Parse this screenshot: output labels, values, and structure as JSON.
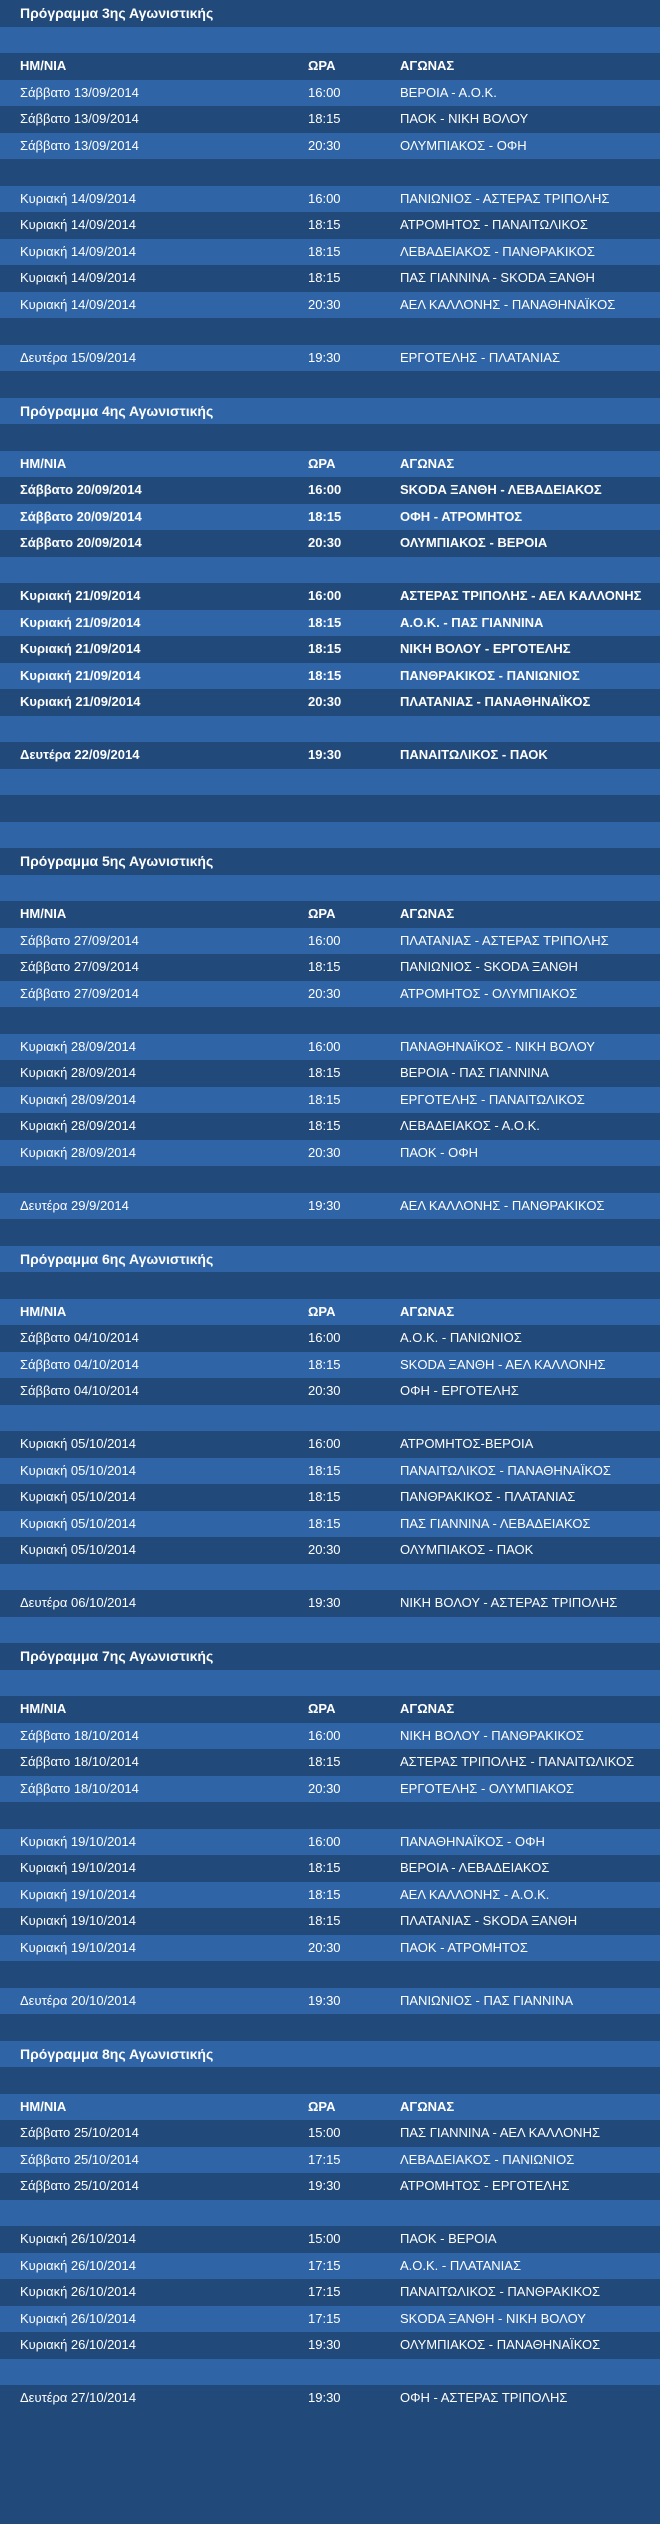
{
  "header": {
    "date": "ΗΜ/ΝΙΑ",
    "time": "ΩΡΑ",
    "match": "ΑΓΩΝΑΣ"
  },
  "rounds": [
    {
      "title": "Πρόγραμμα 3ης Αγωνιστικής",
      "bold": false,
      "groups": [
        [
          [
            "Σάββατο 13/09/2014",
            "16:00",
            "ΒΕΡΟΙΑ - Α.Ο.Κ."
          ],
          [
            "Σάββατο 13/09/2014",
            "18:15",
            "ΠΑΟΚ - ΝΙΚΗ ΒΟΛΟΥ"
          ],
          [
            "Σάββατο 13/09/2014",
            "20:30",
            "ΟΛΥΜΠΙΑΚΟΣ - ΟΦΗ"
          ]
        ],
        [
          [
            "Κυριακή 14/09/2014",
            "16:00",
            "ΠΑΝΙΩΝΙΟΣ - ΑΣΤΕΡΑΣ ΤΡΙΠΟΛΗΣ"
          ],
          [
            "Κυριακή 14/09/2014",
            "18:15",
            "ΑΤΡΟΜΗΤΟΣ - ΠΑΝΑΙΤΩΛΙΚΟΣ"
          ],
          [
            "Κυριακή 14/09/2014",
            "18:15",
            "ΛΕΒΑΔΕΙΑΚΟΣ - ΠΑΝΘΡΑΚΙΚΟΣ"
          ],
          [
            "Κυριακή 14/09/2014",
            "18:15",
            "ΠΑΣ ΓΙΑΝΝΙΝΑ - SKODA ΞΑΝΘΗ"
          ],
          [
            "Κυριακή 14/09/2014",
            "20:30",
            "ΑΕΛ ΚΑΛΛΟΝΗΣ - ΠΑΝΑΘΗΝΑΪΚΟΣ"
          ]
        ],
        [
          [
            "Δευτέρα 15/09/2014",
            "19:30",
            "ΕΡΓΟΤΕΛΗΣ - ΠΛΑΤΑΝΙΑΣ"
          ]
        ]
      ]
    },
    {
      "title": "Πρόγραμμα 4ης Αγωνιστικής",
      "bold": true,
      "groups": [
        [
          [
            "Σάββατο 20/09/2014",
            "16:00",
            "SKODA ΞΑΝΘΗ - ΛΕΒΑΔΕΙΑΚΟΣ"
          ],
          [
            "Σάββατο 20/09/2014",
            "18:15",
            "ΟΦΗ - ΑΤΡΟΜΗΤΟΣ"
          ],
          [
            "Σάββατο 20/09/2014",
            "20:30",
            "ΟΛΥΜΠΙΑΚΟΣ - ΒΕΡΟΙΑ"
          ]
        ],
        [
          [
            "Κυριακή 21/09/2014",
            "16:00",
            "ΑΣΤΕΡΑΣ ΤΡΙΠΟΛΗΣ - ΑΕΛ ΚΑΛΛΟΝΗΣ"
          ],
          [
            "Κυριακή 21/09/2014",
            "18:15",
            "Α.Ο.Κ. - ΠΑΣ ΓΙΑΝΝΙΝΑ"
          ],
          [
            "Κυριακή 21/09/2014",
            "18:15",
            "ΝΙΚΗ ΒΟΛΟΥ - ΕΡΓΟΤΕΛΗΣ"
          ],
          [
            "Κυριακή 21/09/2014",
            "18:15",
            "ΠΑΝΘΡΑΚΙΚΟΣ - ΠΑΝΙΩΝΙΟΣ"
          ],
          [
            "Κυριακή 21/09/2014",
            "20:30",
            "ΠΛΑΤΑΝΙΑΣ - ΠΑΝΑΘΗΝΑΪΚΟΣ"
          ]
        ],
        [
          [
            "Δευτέρα 22/09/2014",
            "19:30",
            "ΠΑΝΑΙΤΩΛΙΚΟΣ - ΠΑΟΚ"
          ]
        ]
      ]
    },
    {
      "title": "Πρόγραμμα 5ης Αγωνιστικής",
      "bold": false,
      "groups": [
        [
          [
            "Σάββατο 27/09/2014",
            "16:00",
            "ΠΛΑΤΑΝΙΑΣ - ΑΣΤΕΡΑΣ ΤΡΙΠΟΛΗΣ"
          ],
          [
            "Σάββατο 27/09/2014",
            "18:15",
            "ΠΑΝΙΩΝΙΟΣ - SKODA ΞΑΝΘΗ"
          ],
          [
            "Σάββατο 27/09/2014",
            "20:30",
            "ΑΤΡΟΜΗΤΟΣ - ΟΛΥΜΠΙΑΚΟΣ"
          ]
        ],
        [
          [
            "Κυριακή 28/09/2014",
            "16:00",
            "ΠΑΝΑΘΗΝΑΪΚΟΣ - ΝΙΚΗ ΒΟΛΟΥ"
          ],
          [
            "Κυριακή 28/09/2014",
            "18:15",
            "ΒΕΡΟΙΑ - ΠΑΣ ΓΙΑΝΝΙΝΑ"
          ],
          [
            "Κυριακή 28/09/2014",
            "18:15",
            "ΕΡΓΟΤΕΛΗΣ - ΠΑΝΑΙΤΩΛΙΚΟΣ"
          ],
          [
            "Κυριακή 28/09/2014",
            "18:15",
            "ΛΕΒΑΔΕΙΑΚΟΣ - Α.Ο.Κ."
          ],
          [
            "Κυριακή 28/09/2014",
            "20:30",
            "ΠΑΟΚ - ΟΦΗ"
          ]
        ],
        [
          [
            "Δευτέρα 29/9/2014",
            "19:30",
            "ΑΕΛ ΚΑΛΛΟΝΗΣ - ΠΑΝΘΡΑΚΙΚΟΣ"
          ]
        ]
      ]
    },
    {
      "title": "Πρόγραμμα 6ης Αγωνιστικής",
      "bold": false,
      "groups": [
        [
          [
            "Σάββατο 04/10/2014",
            "16:00",
            "Α.Ο.Κ. - ΠΑΝΙΩΝΙΟΣ"
          ],
          [
            "Σάββατο 04/10/2014",
            "18:15",
            "SKODA ΞΑΝΘΗ - ΑΕΛ ΚΑΛΛΟΝΗΣ"
          ],
          [
            "Σάββατο 04/10/2014",
            "20:30",
            "ΟΦΗ - ΕΡΓΟΤΕΛΗΣ"
          ]
        ],
        [
          [
            "Κυριακή 05/10/2014",
            "16:00",
            "ΑΤΡΟΜΗΤΟΣ-ΒΕΡΟΙΑ"
          ],
          [
            "Κυριακή 05/10/2014",
            "18:15",
            "ΠΑΝΑΙΤΩΛΙΚΟΣ - ΠΑΝΑΘΗΝΑΪΚΟΣ"
          ],
          [
            "Κυριακή 05/10/2014",
            "18:15",
            "ΠΑΝΘΡΑΚΙΚΟΣ - ΠΛΑΤΑΝΙΑΣ"
          ],
          [
            "Κυριακή 05/10/2014",
            "18:15",
            "ΠΑΣ ΓΙΑΝΝΙΝΑ - ΛΕΒΑΔΕΙΑΚΟΣ"
          ],
          [
            "Κυριακή 05/10/2014",
            "20:30",
            "ΟΛΥΜΠΙΑΚΟΣ - ΠΑΟΚ"
          ]
        ],
        [
          [
            "Δευτέρα 06/10/2014",
            "19:30",
            "ΝΙΚΗ ΒΟΛΟΥ - ΑΣΤΕΡΑΣ ΤΡΙΠΟΛΗΣ"
          ]
        ]
      ]
    },
    {
      "title": "Πρόγραμμα 7ης Αγωνιστικής",
      "bold": false,
      "groups": [
        [
          [
            "Σάββατο 18/10/2014",
            "16:00",
            "ΝΙΚΗ ΒΟΛΟΥ - ΠΑΝΘΡΑΚΙΚΟΣ"
          ],
          [
            "Σάββατο 18/10/2014",
            "18:15",
            "ΑΣΤΕΡΑΣ ΤΡΙΠΟΛΗΣ - ΠΑΝΑΙΤΩΛΙΚΟΣ"
          ],
          [
            "Σάββατο 18/10/2014",
            "20:30",
            "ΕΡΓΟΤΕΛΗΣ - ΟΛΥΜΠΙΑΚΟΣ"
          ]
        ],
        [
          [
            "Κυριακή 19/10/2014",
            "16:00",
            "ΠΑΝΑΘΗΝΑΪΚΟΣ - ΟΦΗ"
          ],
          [
            "Κυριακή 19/10/2014",
            "18:15",
            "ΒΕΡΟΙΑ - ΛΕΒΑΔΕΙΑΚΟΣ"
          ],
          [
            "Κυριακή 19/10/2014",
            "18:15",
            "ΑΕΛ ΚΑΛΛΟΝΗΣ - Α.Ο.Κ."
          ],
          [
            "Κυριακή 19/10/2014",
            "18:15",
            "ΠΛΑΤΑΝΙΑΣ - SKODA ΞΑΝΘΗ"
          ],
          [
            "Κυριακή 19/10/2014",
            "20:30",
            "ΠΑΟΚ - ΑΤΡΟΜΗΤΟΣ"
          ]
        ],
        [
          [
            "Δευτέρα 20/10/2014",
            "19:30",
            "ΠΑΝΙΩΝΙΟΣ - ΠΑΣ ΓΙΑΝΝΙΝΑ"
          ]
        ]
      ]
    },
    {
      "title": "Πρόγραμμα 8ης Αγωνιστικής",
      "bold": false,
      "groups": [
        [
          [
            "Σάββατο 25/10/2014",
            "15:00",
            "ΠΑΣ ΓΙΑΝΝΙΝΑ - ΑΕΛ ΚΑΛΛΟΝΗΣ"
          ],
          [
            "Σάββατο 25/10/2014",
            "17:15",
            "ΛΕΒΑΔΕΙΑΚΟΣ - ΠΑΝΙΩΝΙΟΣ"
          ],
          [
            "Σάββατο 25/10/2014",
            "19:30",
            "ΑΤΡΟΜΗΤΟΣ - ΕΡΓΟΤΕΛΗΣ"
          ]
        ],
        [
          [
            "Κυριακή 26/10/2014",
            "15:00",
            "ΠΑΟΚ - ΒΕΡΟΙΑ"
          ],
          [
            "Κυριακή 26/10/2014",
            "17:15",
            "Α.Ο.Κ. - ΠΛΑΤΑΝΙΑΣ"
          ],
          [
            "Κυριακή 26/10/2014",
            "17:15",
            "ΠΑΝΑΙΤΩΛΙΚΟΣ - ΠΑΝΘΡΑΚΙΚΟΣ"
          ],
          [
            "Κυριακή 26/10/2014",
            "17:15",
            "SKODA ΞΑΝΘΗ - ΝΙΚΗ ΒΟΛΟΥ"
          ],
          [
            "Κυριακή 26/10/2014",
            "19:30",
            "ΟΛΥΜΠΙΑΚΟΣ - ΠΑΝΑΘΗΝΑΪΚΟΣ"
          ]
        ],
        [
          [
            "Δευτέρα 27/10/2014",
            "19:30",
            "ΟΦΗ - ΑΣΤΕΡΑΣ ΤΡΙΠΟΛΗΣ"
          ]
        ]
      ]
    }
  ]
}
